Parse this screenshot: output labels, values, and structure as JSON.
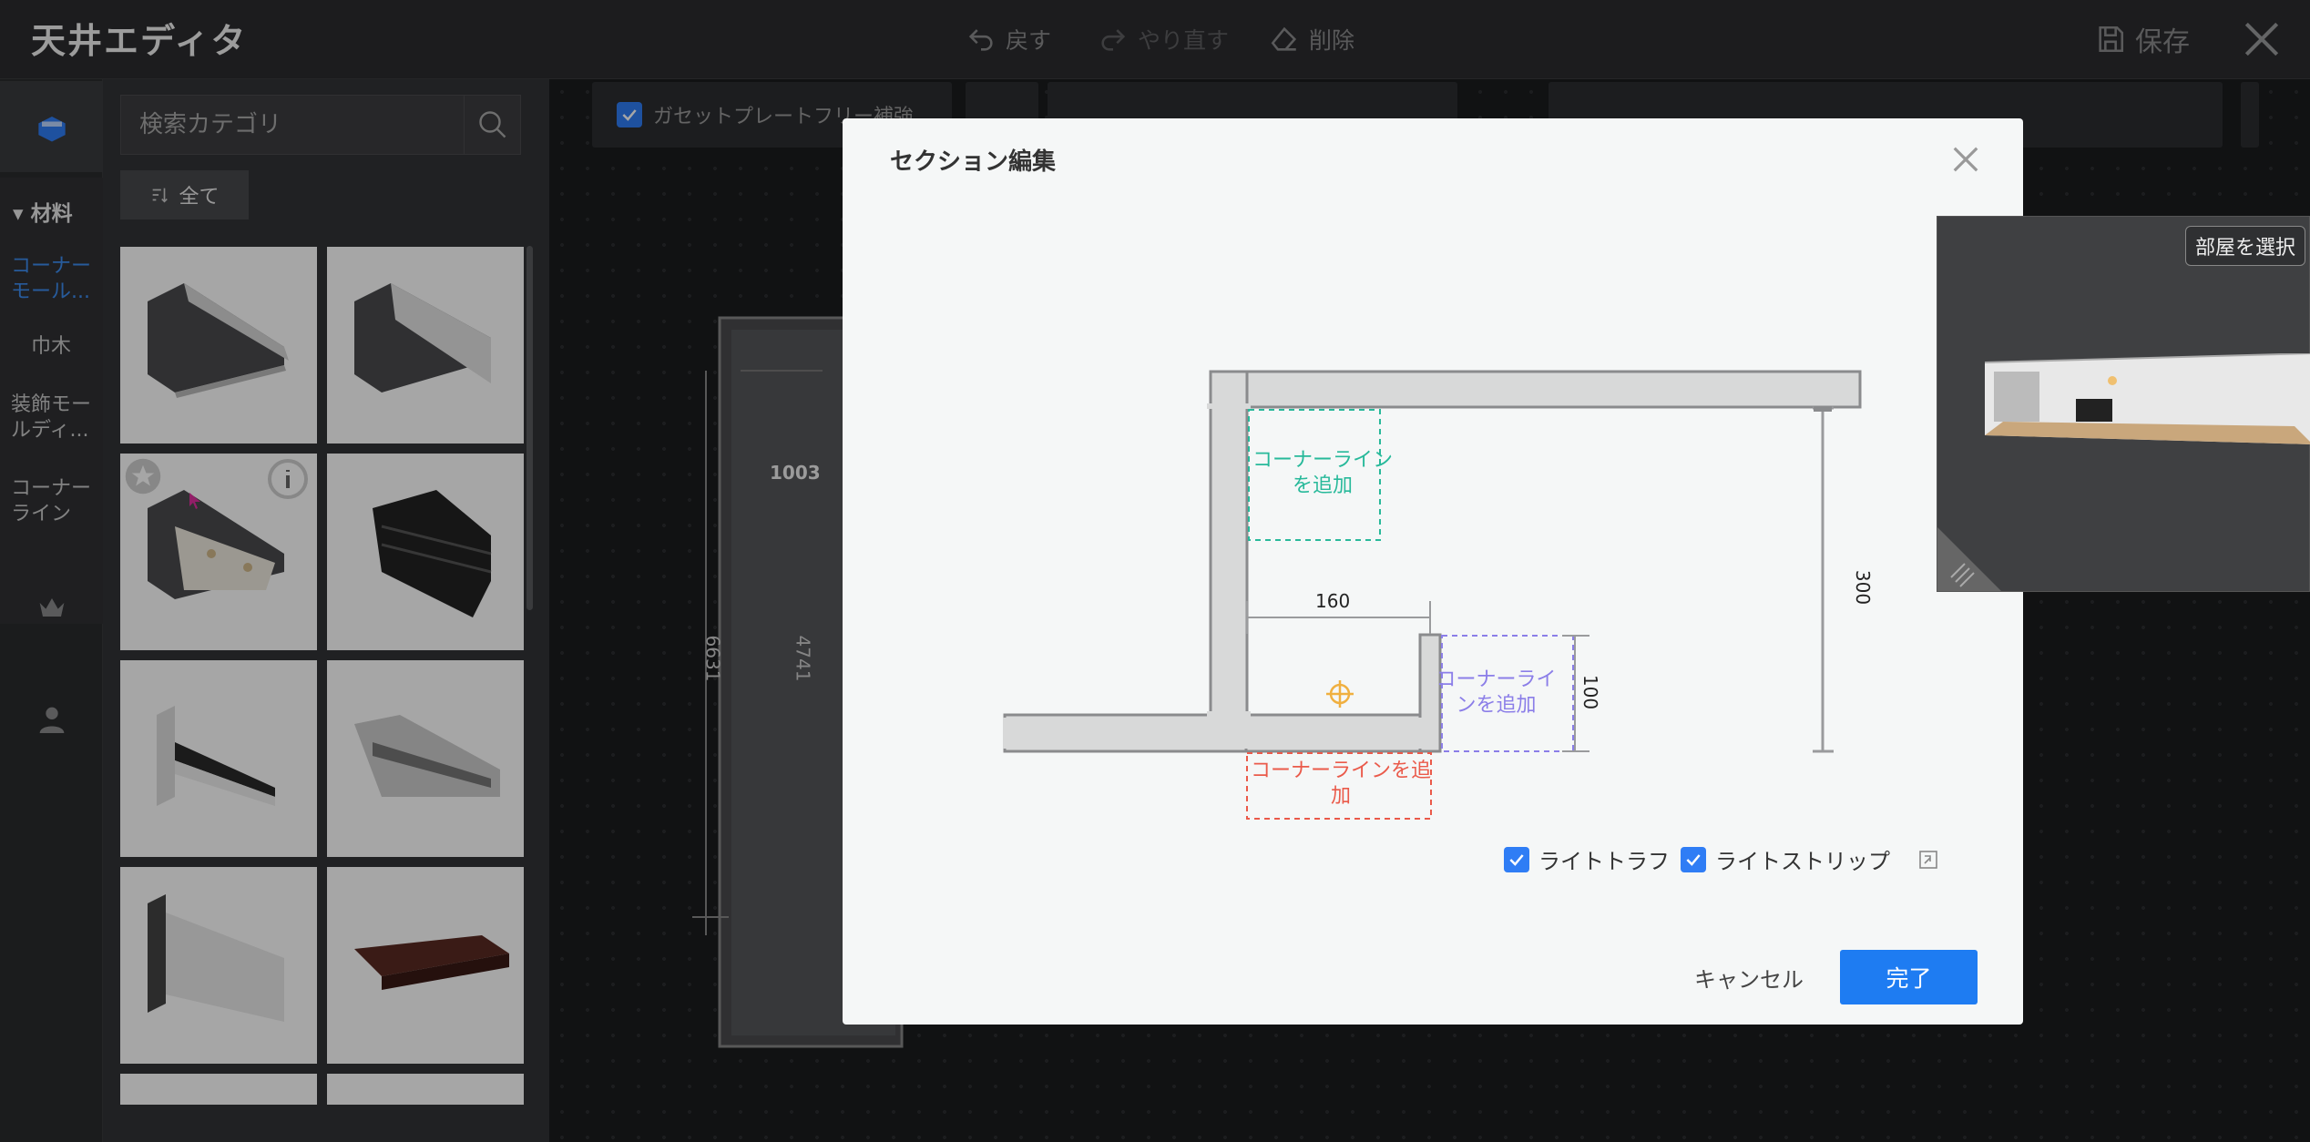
{
  "header": {
    "title": "天井エディタ",
    "undo": "戻す",
    "redo": "やり直す",
    "delete": "削除",
    "save": "保存"
  },
  "rail": {
    "section_label": "材料",
    "categories": [
      {
        "label": "コーナーモール...",
        "active": true
      },
      {
        "label": "巾木",
        "active": false
      },
      {
        "label": "装飾モールディ...",
        "active": false
      },
      {
        "label": "コーナーライン",
        "active": false
      }
    ]
  },
  "catalog": {
    "search_placeholder": "検索カテゴリ",
    "filter_label": "全て"
  },
  "toolbar": {
    "gusset_label": "ガセットプレートフリー補強"
  },
  "canvas": {
    "dim_1003": "1003",
    "dim_4741": "4741",
    "dim_6631": "6631"
  },
  "modal": {
    "title": "セクション編集",
    "add_line_green": "コーナーラインを追加",
    "add_line_purple": "コーナーラインを追加",
    "add_line_red": "コーナーラインを追加",
    "dim_width": "160",
    "dim_height": "100",
    "dim_drop": "300",
    "option_light_trough": "ライトトラフ",
    "option_light_strip": "ライトストリップ",
    "cancel": "キャンセル",
    "done": "完了"
  },
  "preview": {
    "room_select": "部屋を選択"
  },
  "colors": {
    "accent": "#1e7cf2",
    "green": "#27b99a",
    "purple": "#8b7ee8",
    "red": "#ea5a4a",
    "orange": "#f0b040"
  }
}
